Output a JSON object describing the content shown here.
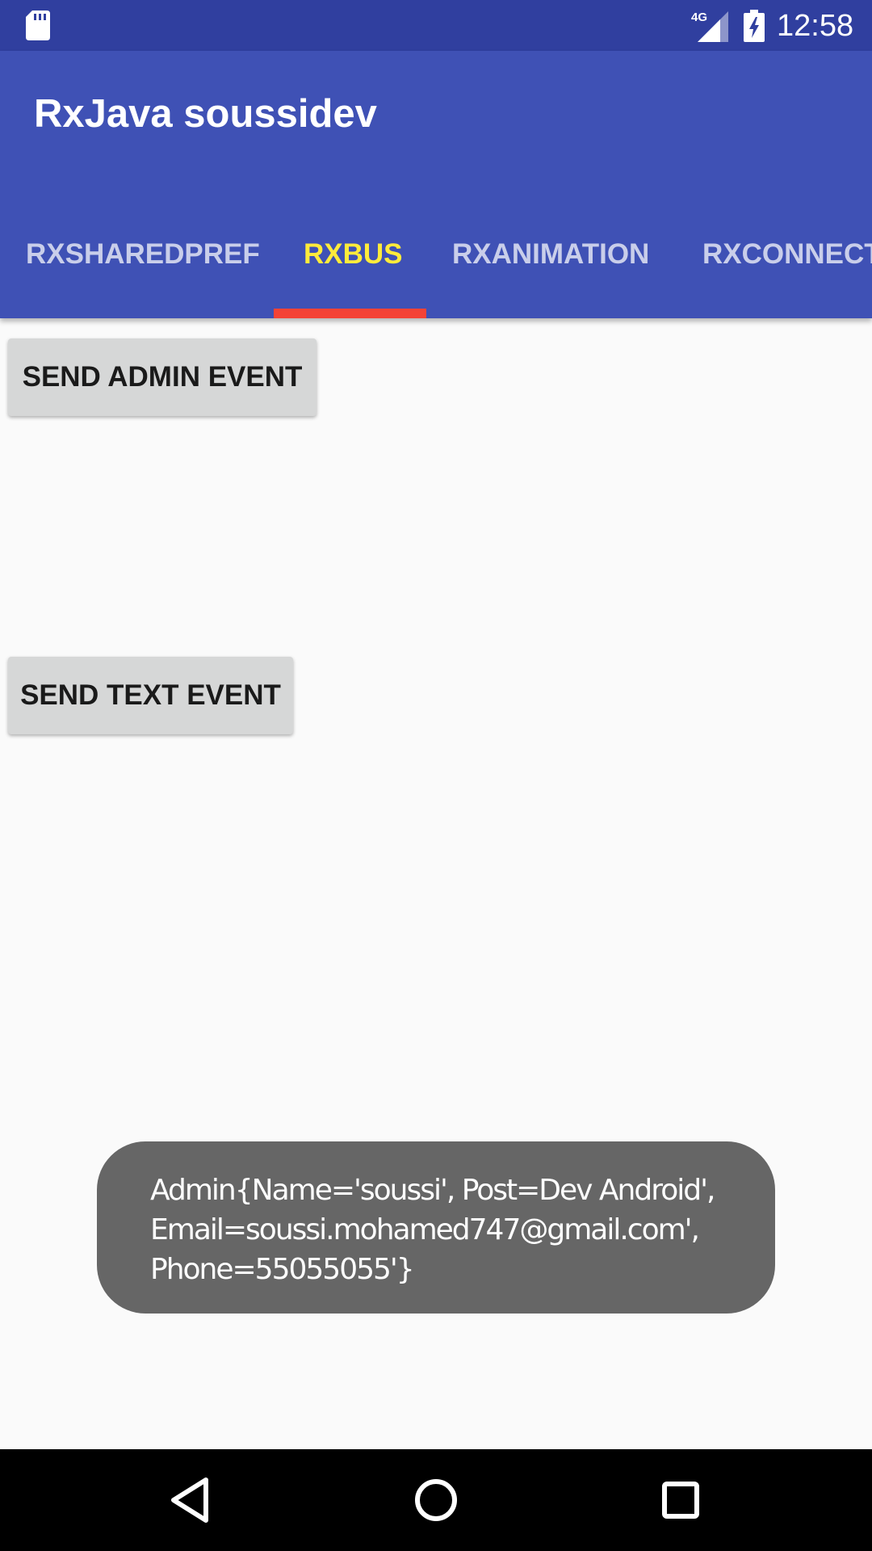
{
  "status_bar": {
    "time": "12:58",
    "network": "4G",
    "icons": [
      "sd-card-icon",
      "signal-icon",
      "battery-charging-icon"
    ]
  },
  "app_bar": {
    "title": "RxJava soussidev"
  },
  "tabs": [
    {
      "label": "RXSHAREDPREF",
      "active": false
    },
    {
      "label": "RXBUS",
      "active": true
    },
    {
      "label": "RXANIMATION",
      "active": false
    },
    {
      "label": "RXCONNECTIVITY",
      "active": false
    }
  ],
  "buttons": {
    "send_admin_event": "SEND ADMIN EVENT",
    "send_text_event": "SEND TEXT EVENT"
  },
  "toast": {
    "lines": [
      "Admin{Name='soussi', Post=Dev Android',",
      "Email=soussi.mohamed747@gmail.com',",
      "Phone=55055055'}"
    ]
  },
  "nav_bar": {
    "icons": [
      "back-icon",
      "home-icon",
      "recents-icon"
    ]
  },
  "colors": {
    "status_bar": "#303f9f",
    "primary": "#3f51b5",
    "tab_active_text": "#ffeb3b",
    "tab_indicator": "#f44336",
    "toast_bg": "#666666"
  }
}
